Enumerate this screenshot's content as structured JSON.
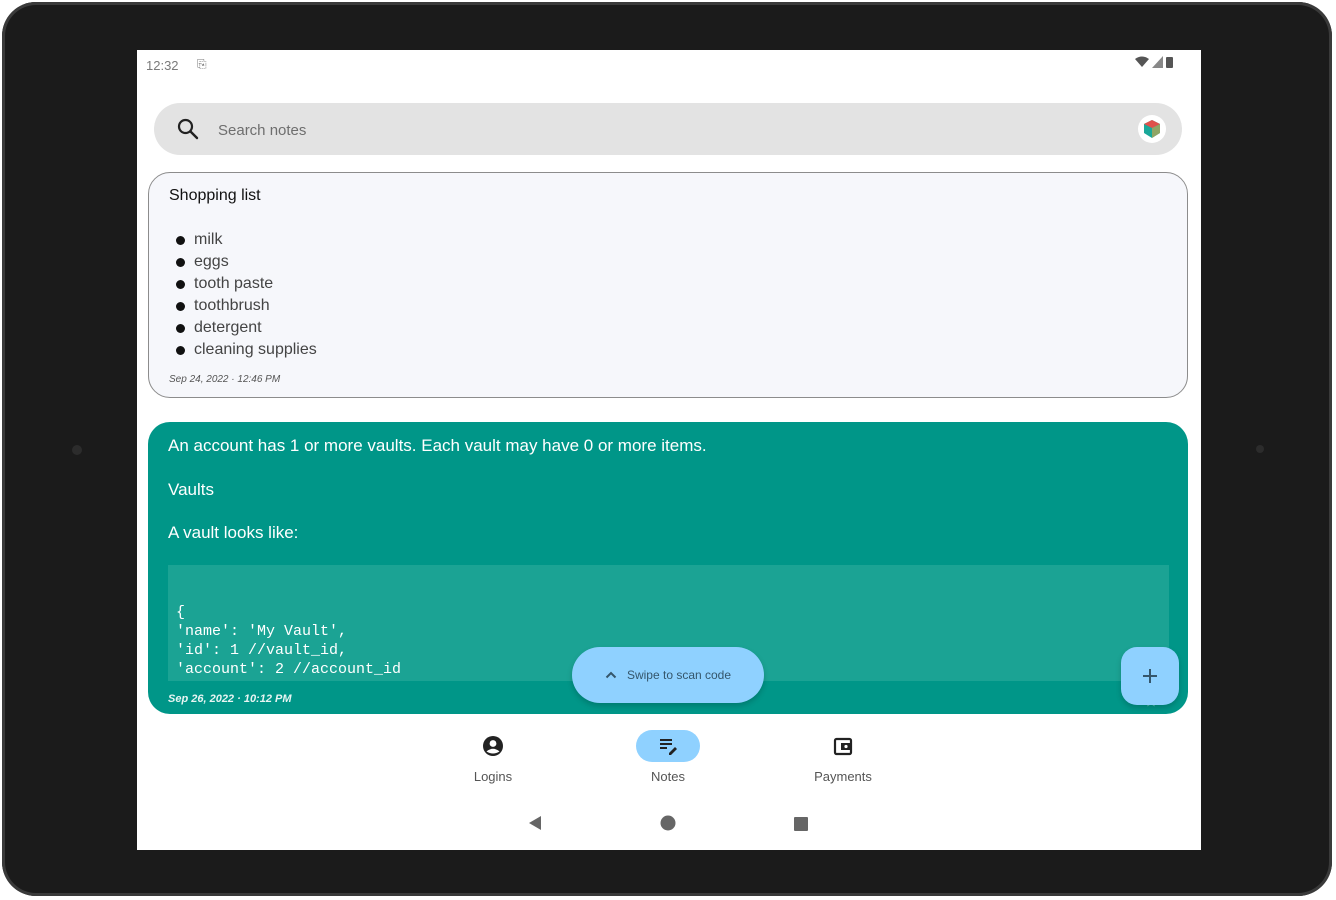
{
  "status_bar": {
    "time": "12:32",
    "sim_glyph": "⎘"
  },
  "search": {
    "placeholder": "Search notes"
  },
  "notes": [
    {
      "title": "Shopping list",
      "items": [
        "milk",
        "eggs",
        "tooth paste",
        "toothbrush",
        "detergent",
        "cleaning supplies"
      ],
      "date": "Sep 24, 2022 · 12:46 PM"
    },
    {
      "line1": "An account has 1 or more vaults. Each vault may have 0 or more items.",
      "line2": "Vaults",
      "line3": "A vault looks like:",
      "code": "{\n'name': 'My Vault',\n'id': 1 //vault_id,\n'account': 2 //account_id",
      "date": "Sep 26, 2022 · 10:12 PM",
      "color": "#009688"
    }
  ],
  "swipe": {
    "label": "Swipe to scan code"
  },
  "fab": {
    "label": "+"
  },
  "nav": {
    "items": [
      {
        "label": "Logins",
        "icon": "account-circle-icon"
      },
      {
        "label": "Notes",
        "icon": "notes-edit-icon",
        "active": true
      },
      {
        "label": "Payments",
        "icon": "wallet-icon"
      }
    ]
  },
  "colors": {
    "accent": "#8fd1ff",
    "note_teal": "#009688",
    "code_bg": "#1ba394"
  }
}
